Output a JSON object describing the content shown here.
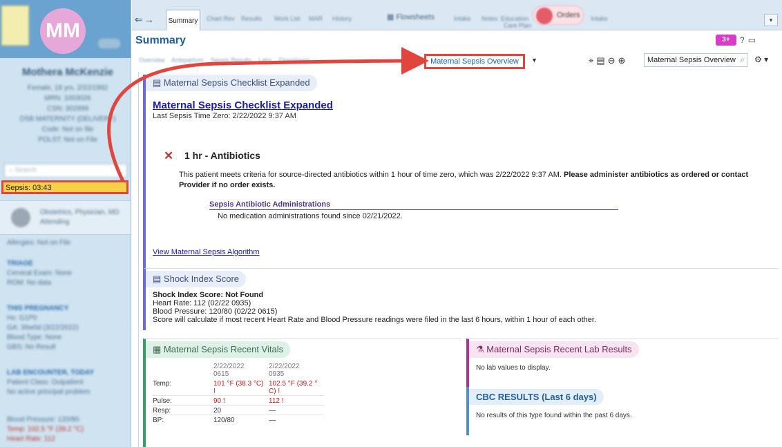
{
  "patient": {
    "initials": "MM",
    "name": "Mothera McKenzie",
    "demographics": [
      "Female, 18 yrs, 2/22/1992",
      "MRN: 1003026",
      "CSN: 302899",
      "DSB MATERNITY (DELIVERY)",
      "Code: Not on file",
      "POLST: Not on File"
    ],
    "search_placeholder": "Search",
    "sepsis_timer": "Sepsis: 03:43",
    "care_provider": "Obstetrics, Physician, MD",
    "care_role": "Attending",
    "allergies": "Allergies: Not on File",
    "blocks": [
      {
        "header": "TRIAGE",
        "lines": [
          "Cervical Exam: None",
          "ROM: No data"
        ]
      },
      {
        "header": "THIS PREGNANCY",
        "lines": [
          "Hx: G1P0",
          "GA: 36w0d (3/22/2022)",
          "Blood Type: None",
          "GBS: No Result"
        ]
      },
      {
        "header": "LAB ENCOUNTER, TODAY",
        "lines": [
          "Patient Class: Outpatient",
          "No active principal problem"
        ]
      },
      {
        "header": "",
        "lines": [
          "Blood Pressure: 120/80",
          "Temp: 102.5 °F (39.2 °C)",
          "Heart Rate: 112"
        ]
      }
    ]
  },
  "tabs": {
    "summary": "Summary",
    "blurred": [
      "Chart Rev",
      "Results",
      "Work List",
      "MAR",
      "History"
    ],
    "flowsheets": "Flowsheets",
    "blurred2": [
      "Intake",
      "Notes",
      "Education",
      "Care Plan"
    ],
    "orders": "Orders",
    "blurred3": [
      "Intake"
    ]
  },
  "header": {
    "title": "Summary",
    "badge": "3+",
    "help_icon": "?",
    "view_selected": "Maternal Sepsis Overview",
    "search_value": "Maternal Sepsis Overview",
    "toolbar_blurred": [
      "Overview",
      "Antepartum",
      "Sepsis Results",
      "Labs",
      "Flowsheets"
    ]
  },
  "checklist": {
    "panel_title": "Maternal Sepsis Checklist Expanded",
    "link_title": "Maternal Sepsis Checklist Expanded",
    "last_time_zero": "Last Sepsis Time Zero: 2/22/2022  9:37 AM",
    "abx_title": "1 hr - Antibiotics",
    "abx_message": "This patient meets criteria for source-directed antibiotics within 1 hour of time zero, which was 2/22/2022  9:37 AM.",
    "abx_action": "Please administer antibiotics as ordered or contact Provider if no order exists.",
    "admin_header": "Sepsis Antibiotic Administrations",
    "admin_message": "No medication administrations found since 02/21/2022.",
    "algorithm_link": "View Maternal Sepsis Algorithm"
  },
  "shock": {
    "panel_title": "Shock Index Score",
    "score_line": "Shock Index Score: Not Found",
    "heart_rate": "Heart Rate: 112 (02/22 0935)",
    "blood_pressure": "Blood Pressure: 120/80 (02/22 0615)",
    "note": "Score will calculate if most recent Heart Rate and Blood Pressure readings were filed in the last 6 hours, within 1 hour of each other."
  },
  "vitals": {
    "panel_title": "Maternal Sepsis Recent Vitals",
    "dates": [
      [
        "2/22/2022",
        "0615"
      ],
      [
        "2/22/2022",
        "0935"
      ]
    ],
    "rows": [
      {
        "label": "Temp:",
        "v1": "101 °F (38.3 °C)",
        "v1b": "!",
        "v2": "102.5 °F (39.2 °",
        "v2b": "C) !"
      },
      {
        "label": "Pulse:",
        "v1": "90 !",
        "v1b": "",
        "v2": "112 !",
        "v2b": ""
      },
      {
        "label": "Resp:",
        "v1": "20",
        "v1b": "",
        "v2": "—",
        "v2b": ""
      },
      {
        "label": "BP:",
        "v1": "120/80",
        "v1b": "",
        "v2": "—",
        "v2b": ""
      }
    ]
  },
  "labs": {
    "panel_title": "Maternal Sepsis Recent Lab Results",
    "message": "No lab values to display."
  },
  "cbc": {
    "panel_title": "CBC RESULTS (Last 6 days)",
    "message": "No results of this type found within the past 6 days."
  },
  "colors": {
    "highlight_red": "#e0463e",
    "timer_yellow": "#f7d04a",
    "link_blue": "#1a1aaa",
    "alert_red": "#b62020"
  }
}
